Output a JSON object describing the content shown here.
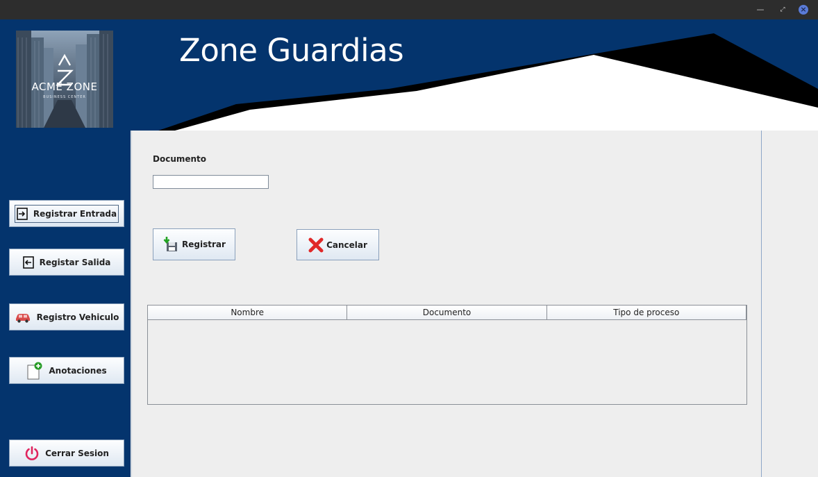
{
  "window": {
    "minimize_glyph": "—",
    "maximize_glyph": "⤢",
    "close_glyph": "×"
  },
  "header": {
    "title": "Zone Guardias",
    "logo": {
      "name": "ACME ZONE",
      "tagline": "BUSINESS CENTER",
      "mark": "Z"
    },
    "colors": {
      "background": "#04346d",
      "accent_stripe": "#000000",
      "panel": "#ffffff"
    }
  },
  "sidebar": {
    "items": [
      {
        "label": "Registrar Entrada",
        "icon": "login-arrow-icon"
      },
      {
        "label": "Registar Salida",
        "icon": "logout-arrow-icon"
      },
      {
        "label": "Registro Vehiculo",
        "icon": "car-icon"
      },
      {
        "label": "Anotaciones",
        "icon": "add-note-icon"
      },
      {
        "label": "Cerrar Sesion",
        "icon": "power-icon"
      }
    ]
  },
  "form": {
    "document_label": "Documento",
    "document_value": "",
    "register_label": "Registrar",
    "cancel_label": "Cancelar"
  },
  "table": {
    "columns": [
      "Nombre",
      "Documento",
      "Tipo de proceso"
    ],
    "rows": []
  }
}
